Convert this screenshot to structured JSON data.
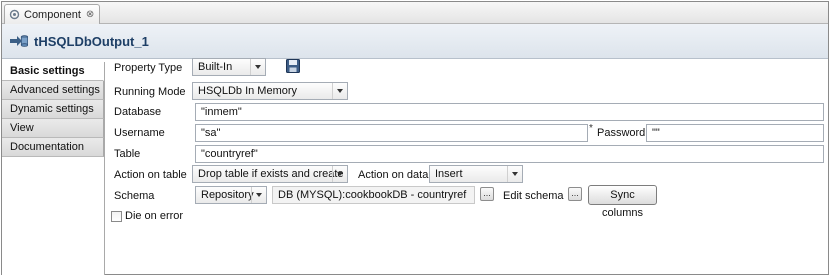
{
  "tab": {
    "label": "Component",
    "close_glyph": "⊗"
  },
  "component": {
    "title": "tHSQLDbOutput_1"
  },
  "nav": {
    "items": [
      {
        "label": "Basic settings",
        "active": true
      },
      {
        "label": "Advanced settings",
        "active": false
      },
      {
        "label": "Dynamic settings",
        "active": false
      },
      {
        "label": "View",
        "active": false
      },
      {
        "label": "Documentation",
        "active": false
      }
    ]
  },
  "form": {
    "property_type": {
      "label": "Property Type",
      "value": "Built-In"
    },
    "running_mode": {
      "label": "Running Mode",
      "value": "HSQLDb In Memory"
    },
    "database": {
      "label": "Database",
      "value": "\"inmem\""
    },
    "username": {
      "label": "Username",
      "value": "\"sa\""
    },
    "password": {
      "required_mark": "*",
      "label": "Password",
      "value": "\"\""
    },
    "table": {
      "label": "Table",
      "value": "\"countryref\""
    },
    "action_on_table": {
      "label": "Action on table",
      "value": "Drop table if exists and create"
    },
    "action_on_data": {
      "label": "Action on data",
      "value": "Insert"
    },
    "schema": {
      "label": "Schema",
      "type_value": "Repository",
      "repo_value": "DB (MYSQL):cookbookDB - countryref",
      "browse_label": "...",
      "edit_label": "Edit schema",
      "edit_button_label": "...",
      "sync_label": "Sync columns"
    },
    "die_on_error": {
      "label": "Die on error",
      "checked": false
    }
  },
  "icons": {
    "tab_icon": "component-plug-icon",
    "title_icon": "db-output-icon",
    "save_icon": "floppy-disk-icon"
  }
}
